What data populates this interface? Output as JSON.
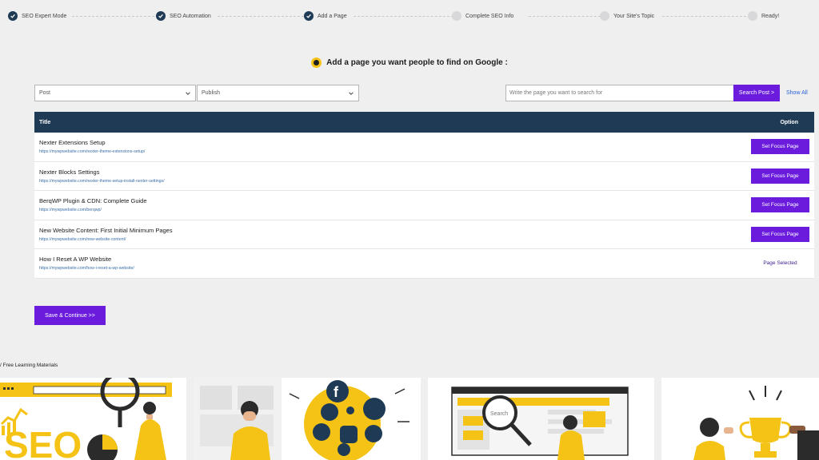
{
  "steps": [
    {
      "label": "SEO Expert Mode",
      "done": true
    },
    {
      "label": "SEO Automation",
      "done": true
    },
    {
      "label": "Add a Page",
      "done": true
    },
    {
      "label": "Complete SEO Info",
      "done": false
    },
    {
      "label": "Your Site's Topic",
      "done": false
    },
    {
      "label": "Ready!",
      "done": false
    }
  ],
  "heading": "Add a page you want people to find on Google :",
  "filters": {
    "post_type": "Post",
    "status": "Publish",
    "search_placeholder": "Write the page you want to search for",
    "search_button": "Search Post >",
    "show_all": "Show All"
  },
  "table": {
    "col_title": "Title",
    "col_option": "Option",
    "rows": [
      {
        "title": "Nexter Extensions Setup",
        "url": "https://mywpwebsite.com/nexter-theme-extensions-setup/",
        "action": "Set Focus Page"
      },
      {
        "title": "Nexter Blocks Settings",
        "url": "https://mywpwebsite.com/nexter-theme-setup-install-nexter-settings/",
        "action": "Set Focus Page"
      },
      {
        "title": "BerqWP Plugin & CDN: Complete Guide",
        "url": "https://mywpwebsite.com/berqwp/",
        "action": "Set Focus Page"
      },
      {
        "title": "New Website Content: First Initial Minimum Pages",
        "url": "https://mywpwebsite.com/new-website-content/",
        "action": "Set Focus Page"
      },
      {
        "title": "How I Reset A WP Website",
        "url": "https://mywpwebsite.com/how-i-reset-a-wp-website/",
        "action": "Page Selected"
      }
    ]
  },
  "save_button": "Save & Continue >>",
  "learning_title": "/ Free Learning Materials",
  "cards": {
    "seo_text": "SEO",
    "search_text": "Search"
  },
  "colors": {
    "accent": "#6a1bdc",
    "header": "#1e3a55",
    "yellow": "#f4c316"
  }
}
